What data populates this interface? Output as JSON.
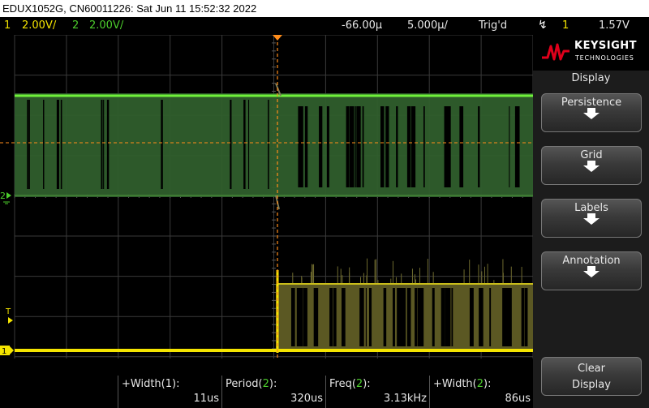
{
  "title_bar": "EDUX1052G, CN60011226: Sat Jun 11 15:52:32 2022",
  "status": {
    "ch1_num": "1",
    "ch1_scale": "2.00V/",
    "ch2_num": "2",
    "ch2_scale": "2.00V/",
    "delay": "-66.00µ",
    "timebase": "5.000µ/",
    "trig_state": "Trig'd",
    "trig_slope_icon": "rising-edge-icon",
    "trig_source": "1",
    "trig_level": "1.57V"
  },
  "markers": {
    "ch2_ground": "2",
    "ch1_ground": "1",
    "trigger_level": "T"
  },
  "logo": {
    "brand": "KEYSIGHT",
    "sub": "TECHNOLOGIES"
  },
  "menu": {
    "title": "Display",
    "softkeys": [
      {
        "label": "Persistence"
      },
      {
        "label": "Grid"
      },
      {
        "label": "Labels"
      },
      {
        "label": "Annotation"
      }
    ],
    "clear_line1": "Clear",
    "clear_line2": "Display"
  },
  "measurements": [
    {
      "label_prefix": "+Width(",
      "channel": "1",
      "label_suffix": "):",
      "value": "11us"
    },
    {
      "label_prefix": "Period(",
      "channel": "2",
      "label_suffix": "):",
      "value": "320us"
    },
    {
      "label_prefix": "Freq(",
      "channel": "2",
      "label_suffix": "):",
      "value": "3.13kHz"
    },
    {
      "label_prefix": "+Width(",
      "channel": "2",
      "label_suffix": "):",
      "value": "86us"
    }
  ],
  "colors": {
    "ch1": "#f4e400",
    "ch2": "#4ccd2c",
    "trigger_marker": "#ff8c1a",
    "keysight_red": "#e0001b"
  }
}
